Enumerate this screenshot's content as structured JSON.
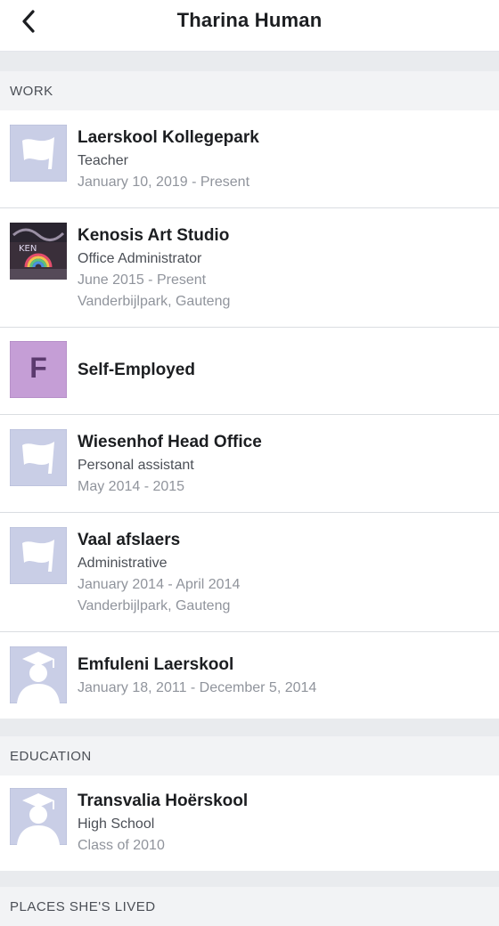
{
  "header": {
    "title": "Tharina Human"
  },
  "work": {
    "heading": "WORK",
    "items": [
      {
        "name": "Laerskool Kollegepark",
        "role": "Teacher",
        "dates": "January 10, 2019 - Present",
        "icon": "flag-placeholder-icon"
      },
      {
        "name": "Kenosis Art Studio",
        "role": "Office Administrator",
        "dates": "June 2015 - Present",
        "location": "Vanderbijlpark, Gauteng",
        "icon": "art-studio-logo"
      },
      {
        "name": "Self-Employed",
        "letter": "F",
        "icon": "letter-avatar",
        "color": "#c59ed6"
      },
      {
        "name": "Wiesenhof Head Office",
        "role": "Personal assistant",
        "dates": "May 2014 - 2015",
        "icon": "flag-placeholder-icon"
      },
      {
        "name": "Vaal afslaers",
        "role": "Administrative",
        "dates": "January 2014 - April 2014",
        "location": "Vanderbijlpark, Gauteng",
        "icon": "flag-placeholder-icon"
      },
      {
        "name": "Emfuleni Laerskool",
        "dates": "January 18, 2011 - December 5, 2014",
        "icon": "graduate-placeholder-icon"
      }
    ]
  },
  "education": {
    "heading": "EDUCATION",
    "items": [
      {
        "name": "Transvalia Hoërskool",
        "level": "High School",
        "class": "Class of 2010",
        "icon": "graduate-placeholder-icon"
      }
    ]
  },
  "places": {
    "heading": "PLACES SHE'S LIVED"
  },
  "colors": {
    "placeholder_bg": "#c9cee6",
    "placeholder_fg": "#ffffff",
    "divider": "#e9ebee"
  }
}
